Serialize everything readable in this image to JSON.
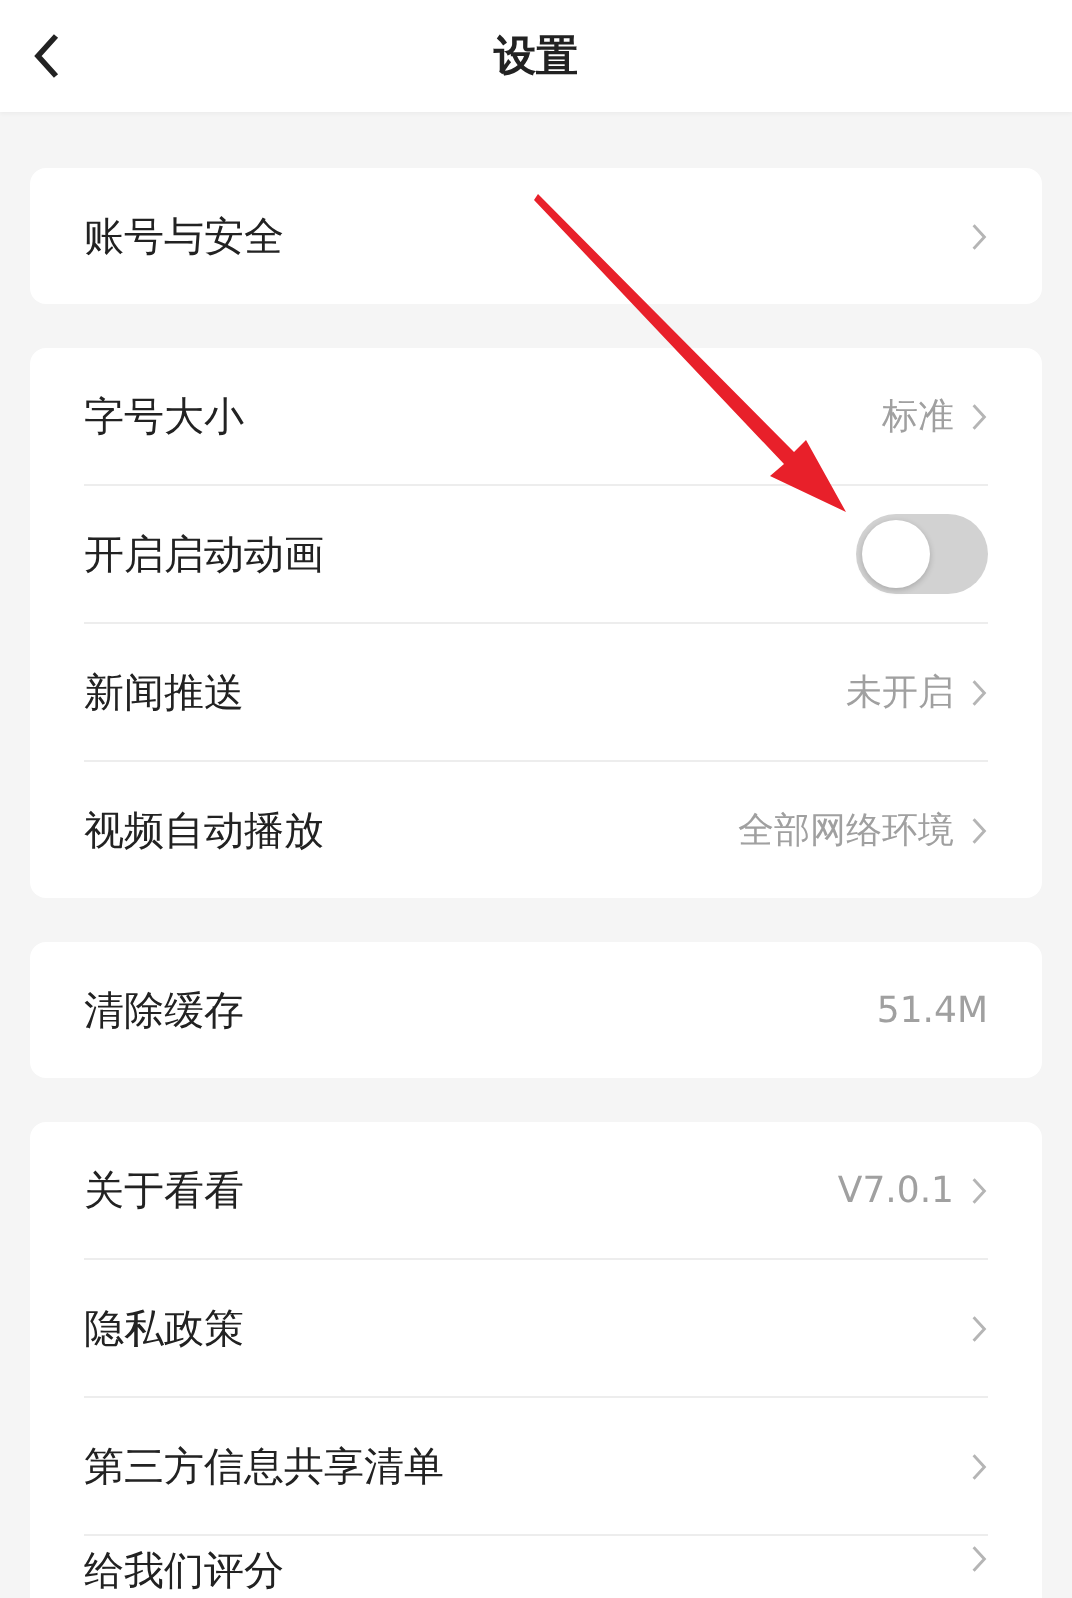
{
  "header": {
    "title": "设置"
  },
  "groups": [
    {
      "rows": [
        {
          "kind": "link",
          "label": "账号与安全"
        }
      ]
    },
    {
      "rows": [
        {
          "kind": "link",
          "label": "字号大小",
          "value": "标准"
        },
        {
          "kind": "toggle",
          "label": "开启启动动画",
          "on": false
        },
        {
          "kind": "link",
          "label": "新闻推送",
          "value": "未开启"
        },
        {
          "kind": "link",
          "label": "视频自动播放",
          "value": "全部网络环境"
        }
      ]
    },
    {
      "rows": [
        {
          "kind": "info",
          "label": "清除缓存",
          "value": "51.4M"
        }
      ]
    },
    {
      "rows": [
        {
          "kind": "link",
          "label": "关于看看",
          "value": "V7.0.1"
        },
        {
          "kind": "link",
          "label": "隐私政策"
        },
        {
          "kind": "link",
          "label": "第三方信息共享清单"
        },
        {
          "kind": "link",
          "label": "给我们评分"
        }
      ]
    }
  ]
}
